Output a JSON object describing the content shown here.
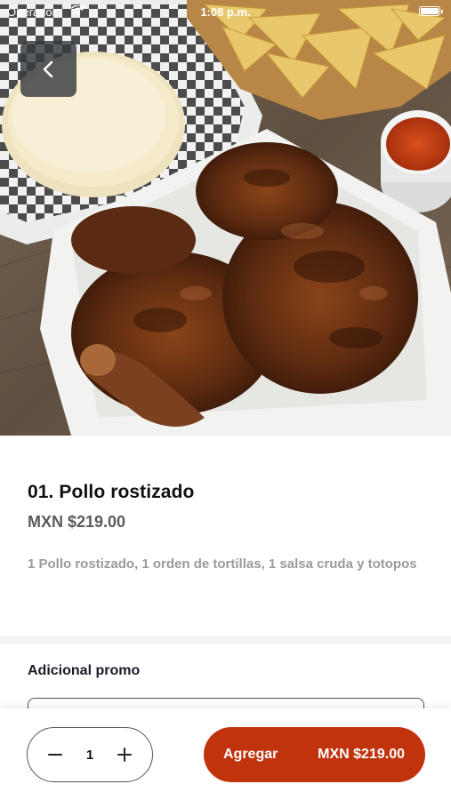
{
  "status_bar": {
    "carrier": "Operador",
    "time": "1:08 p.m."
  },
  "header": {
    "back_icon": "chevron-left-icon",
    "photo_icon": "food-photo"
  },
  "product": {
    "title": "01. Pollo rostizado",
    "price": "MXN $219.00",
    "description": "1 Pollo rostizado, 1 orden de tortillas, 1 salsa cruda y totopos"
  },
  "options": {
    "section_title": "Adicional promo"
  },
  "bottom_bar": {
    "quantity": "1",
    "decrement_icon": "minus-icon",
    "increment_icon": "plus-icon",
    "add_label": "Agregar",
    "add_price": "MXN $219.00"
  },
  "colors": {
    "accent": "#c0330d",
    "title_text": "#111111",
    "price_text": "#5b5b5b",
    "description_text": "#9a9a9a"
  }
}
